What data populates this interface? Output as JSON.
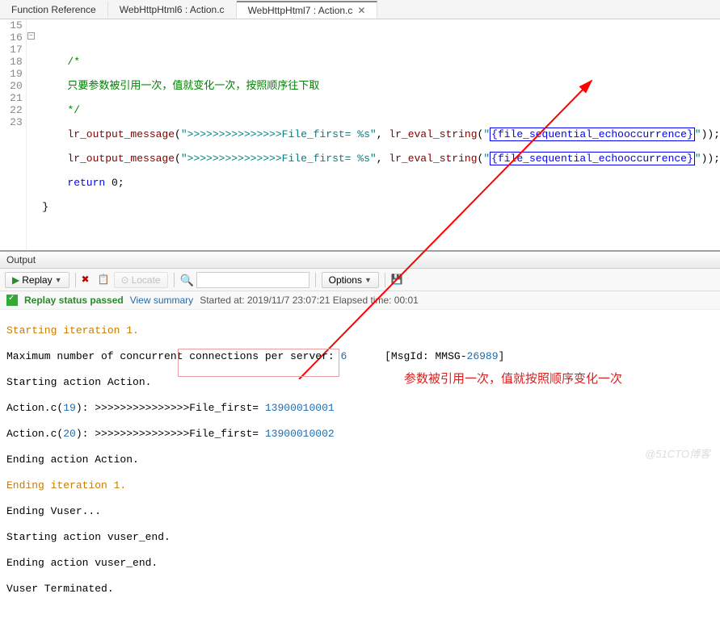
{
  "tabs": [
    {
      "label": "Function Reference"
    },
    {
      "label": "WebHttpHtml6 : Action.c"
    },
    {
      "label": "WebHttpHtml7 : Action.c"
    }
  ],
  "gutter": [
    "15",
    "16",
    "17",
    "18",
    "19",
    "20",
    "21",
    "22",
    "23"
  ],
  "code": {
    "c_open": "/*",
    "c_body": "只要参数被引用一次，值就变化一次，按照顺序往下取",
    "c_close": "*/",
    "func": "lr_output_message",
    "arg1": "\">>>>>>>>>>>>>>>File_first= %s\"",
    "eval": "lr_eval_string",
    "param": "{file_sequential_echooccurrence}",
    "ret": "return",
    "zero": "0"
  },
  "output": {
    "title": "Output",
    "replayBtn": "Replay",
    "locateBtn": "Locate",
    "optionsBtn": "Options",
    "status": "Replay status passed",
    "summary": "View summary",
    "started": "Started at: 2019/11/7 23:07:21 Elapsed time: 00:01",
    "lines": {
      "l1": "Starting iteration 1.",
      "l2a": "Maximum number of concurrent connections per server: ",
      "l2b": "6",
      "l2c": "      [MsgId: MMSG-",
      "l2d": "26989",
      "l2e": "]",
      "l3": "Starting action Action.",
      "l4a": "Action.c(",
      "l4b": "19",
      "l4c": "): >>>>>>>>>>>>>>>File_first= ",
      "l4d": "13900010001",
      "l5a": "Action.c(",
      "l5b": "20",
      "l5c": "): >>>>>>>>>>>>>>>File_first= ",
      "l5d": "13900010002",
      "l6": "Ending action Action.",
      "l7": "Ending iteration 1.",
      "l8": "Ending Vuser...",
      "l9": "Starting action vuser_end.",
      "l10": "Ending action vuser_end.",
      "l11": "Vuser Terminated."
    }
  },
  "annotation": "参数被引用一次，值就按照顺序变化一次",
  "watermark": "@51CTO博客"
}
